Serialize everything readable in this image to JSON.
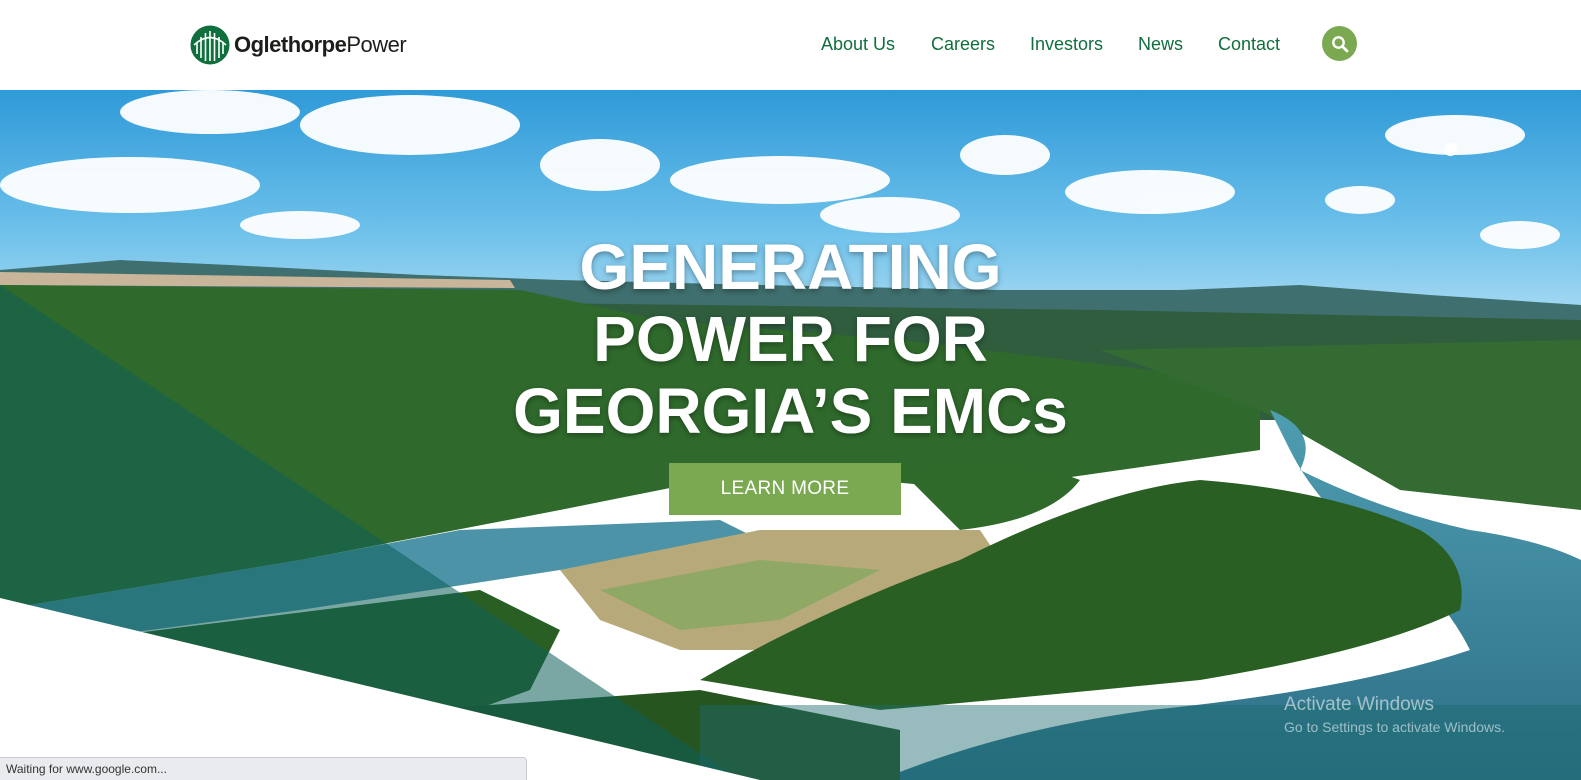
{
  "logo": {
    "text_bold": "Oglethorpe",
    "text_regular": "Power"
  },
  "nav": {
    "items": [
      "About Us",
      "Careers",
      "Investors",
      "News",
      "Contact"
    ]
  },
  "search": {
    "icon": "search-icon"
  },
  "hero": {
    "headline": [
      "GENERATING",
      "POWER FOR",
      "GEORGIA’S EMCs"
    ],
    "cta_label": "LEARN MORE"
  },
  "watermark": {
    "line1": "Activate Windows",
    "line2": "Go to Settings to activate Windows."
  },
  "status_bar": {
    "text": "Waiting for www.google.com..."
  },
  "colors": {
    "brand_green": "#0f6f3d",
    "accent_green": "#7aa952",
    "teal_overlay": "#0d5e58"
  }
}
